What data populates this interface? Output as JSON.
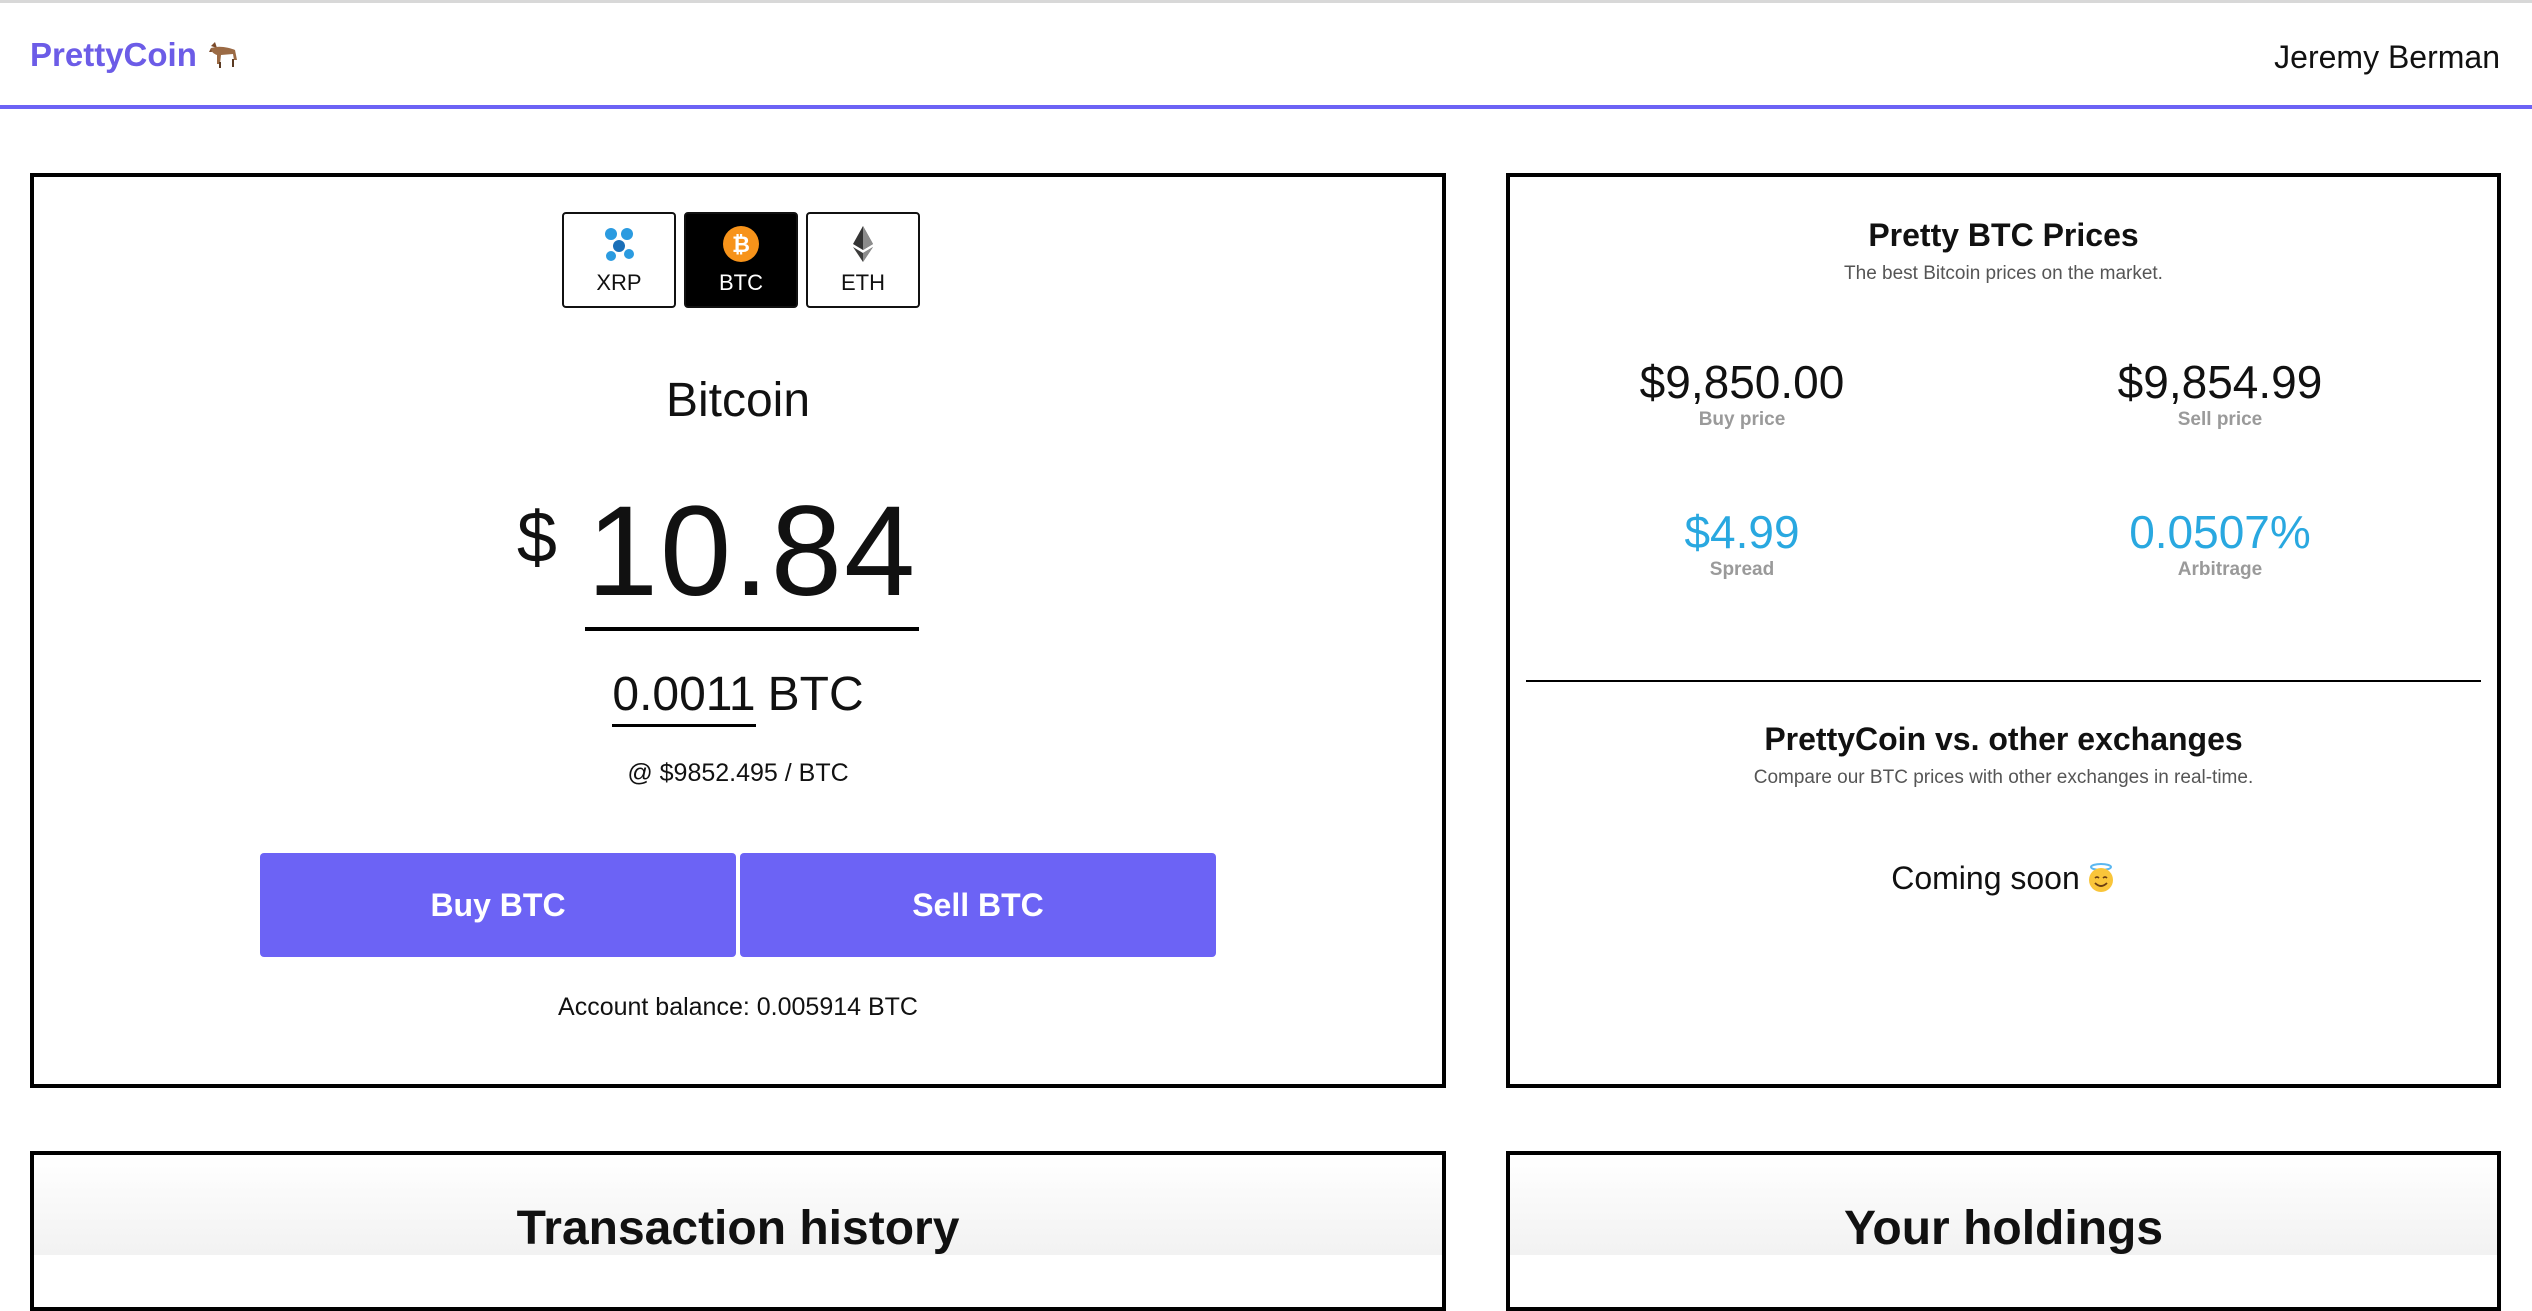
{
  "header": {
    "brand": "PrettyCoin",
    "brand_icon": "goat-icon",
    "user_name": "Jeremy Berman",
    "accent_color": "#6c63f5"
  },
  "converter": {
    "coin_tabs": [
      {
        "label": "XRP",
        "icon": "xrp-icon",
        "active": false
      },
      {
        "label": "BTC",
        "icon": "bitcoin-icon",
        "active": true
      },
      {
        "label": "ETH",
        "icon": "ethereum-icon",
        "active": false
      }
    ],
    "coin_name": "Bitcoin",
    "currency_symbol": "$",
    "usd_amount": "10.84",
    "btc_amount": "0.0011",
    "btc_unit": "BTC",
    "rate_text": "@ $9852.495 / BTC",
    "buy_label": "Buy BTC",
    "sell_label": "Sell BTC",
    "balance_text": "Account balance: 0.005914 BTC"
  },
  "prices": {
    "title": "Pretty BTC Prices",
    "subtitle": "The best Bitcoin prices on the market.",
    "buy_price": "$9,850.00",
    "buy_label": "Buy price",
    "sell_price": "$9,854.99",
    "sell_label": "Sell price",
    "spread": "$4.99",
    "spread_label": "Spread",
    "arbitrage": "0.0507%",
    "arbitrage_label": "Arbitrage",
    "accent_color": "#29a8e0"
  },
  "comparison": {
    "title": "PrettyCoin vs. other exchanges",
    "subtitle": "Compare our BTC prices with other exchanges in real-time.",
    "coming_soon": "Coming soon",
    "emoji": "smiling-face-with-halo-icon"
  },
  "bottom": {
    "transactions_title": "Transaction history",
    "holdings_title": "Your holdings"
  }
}
